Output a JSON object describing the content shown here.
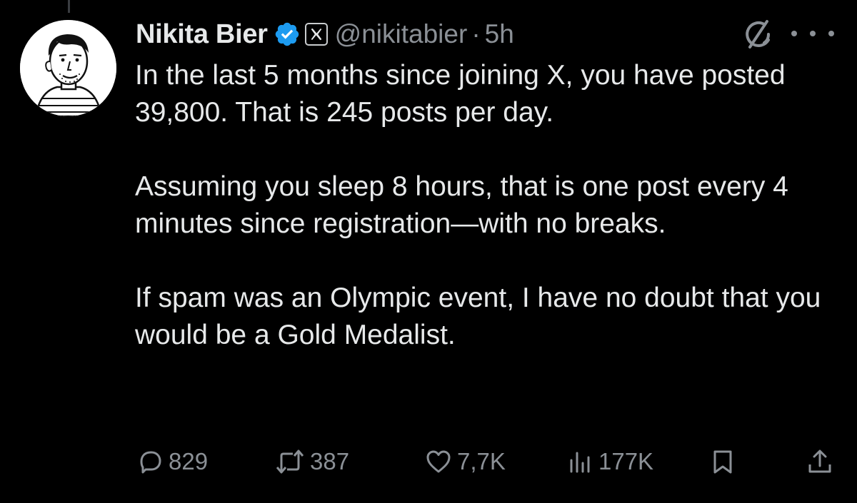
{
  "author": {
    "name": "Nikita Bier",
    "handle": "@nikitabier",
    "separator": "·",
    "timestamp": "5h",
    "verified_color": "#1d9bf0"
  },
  "post": {
    "paragraphs": [
      "In the last 5 months since joining X, you have posted 39,800. That is 245 posts per day.",
      "Assuming you sleep 8 hours, that is one post every 4 minutes since registration—with no breaks.",
      "If spam was an Olympic event, I have no doubt that you would be a Gold Medalist."
    ]
  },
  "actions": {
    "replies": "829",
    "reposts": "387",
    "likes": "7,7K",
    "views": "177K"
  },
  "icons": {
    "verified": "verified-badge-icon",
    "affiliate": "x-logo-icon",
    "grok": "grok-icon",
    "more": "more-dots-icon",
    "reply": "reply-bubble-icon",
    "repost": "repost-icon",
    "like": "heart-icon",
    "views": "bar-chart-icon",
    "bookmark": "bookmark-icon",
    "share": "share-icon"
  },
  "colors": {
    "background": "#000000",
    "text": "#e7e9ea",
    "muted": "#8b9096",
    "accent": "#1d9bf0"
  }
}
